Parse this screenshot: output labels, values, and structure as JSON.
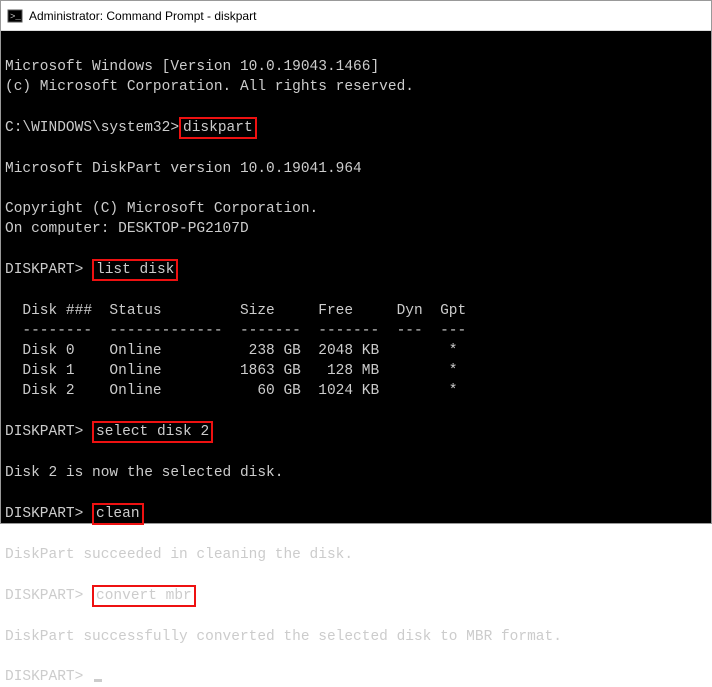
{
  "window": {
    "title": "Administrator: Command Prompt - diskpart"
  },
  "lines": {
    "winver": "Microsoft Windows [Version 10.0.19043.1466]",
    "copyright1": "(c) Microsoft Corporation. All rights reserved.",
    "prompt_sys": "C:\\WINDOWS\\system32>",
    "cmd_diskpart": "diskpart",
    "dp_ver": "Microsoft DiskPart version 10.0.19041.964",
    "dp_copy": "Copyright (C) Microsoft Corporation.",
    "dp_comp": "On computer: DESKTOP-PG2107D",
    "prompt_dp": "DISKPART>",
    "cmd_list": "list disk",
    "tbl_header": "  Disk ###  Status         Size     Free     Dyn  Gpt",
    "tbl_rule": "  --------  -------------  -------  -------  ---  ---",
    "tbl_row0": "  Disk 0    Online          238 GB  2048 KB        *",
    "tbl_row1": "  Disk 1    Online         1863 GB   128 MB        *",
    "tbl_row2": "  Disk 2    Online           60 GB  1024 KB        *",
    "cmd_select": "select disk 2",
    "sel_ok": "Disk 2 is now the selected disk.",
    "cmd_clean": "clean",
    "clean_ok": "DiskPart succeeded in cleaning the disk.",
    "cmd_convert": "convert mbr",
    "convert_ok": "DiskPart successfully converted the selected disk to MBR format."
  },
  "chart_data": {
    "type": "table",
    "title": "list disk",
    "columns": [
      "Disk ###",
      "Status",
      "Size",
      "Free",
      "Dyn",
      "Gpt"
    ],
    "rows": [
      {
        "Disk ###": "Disk 0",
        "Status": "Online",
        "Size": "238 GB",
        "Free": "2048 KB",
        "Dyn": "",
        "Gpt": "*"
      },
      {
        "Disk ###": "Disk 1",
        "Status": "Online",
        "Size": "1863 GB",
        "Free": "128 MB",
        "Dyn": "",
        "Gpt": "*"
      },
      {
        "Disk ###": "Disk 2",
        "Status": "Online",
        "Size": "60 GB",
        "Free": "1024 KB",
        "Dyn": "",
        "Gpt": "*"
      }
    ]
  }
}
